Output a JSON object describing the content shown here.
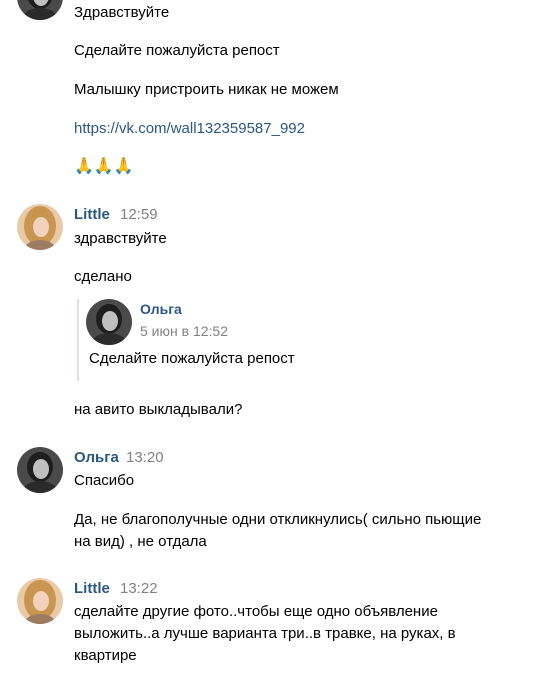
{
  "messages": [
    {
      "lines": [
        "Здравствуйте",
        "Сделайте пожалуйста репост",
        "Малышку пристроить никак не можем"
      ],
      "link": "https://vk.com/wall132359587_992",
      "emoji": "🙏🙏🙏"
    },
    {
      "author": "Little",
      "time": "12:59",
      "lines": [
        "здравствуйте",
        "сделано"
      ],
      "quote": {
        "author": "Ольга",
        "date": "5 июн в 12:52",
        "text": "Сделайте пожалуйста репост"
      },
      "after": "на авито выкладывали?"
    },
    {
      "author": "Ольга",
      "time": "13:20",
      "lines": [
        "Спасибо"
      ],
      "text2": "Да, не благополучные одни откликнулись( сильно пьющие\nна вид) , не отдала"
    },
    {
      "author": "Little",
      "time": "13:22",
      "text": "сделайте другие фото..чтобы еще одно объявление\nвыложить..а лучше варианта три..в травке, на руках, в\nквартире"
    }
  ]
}
